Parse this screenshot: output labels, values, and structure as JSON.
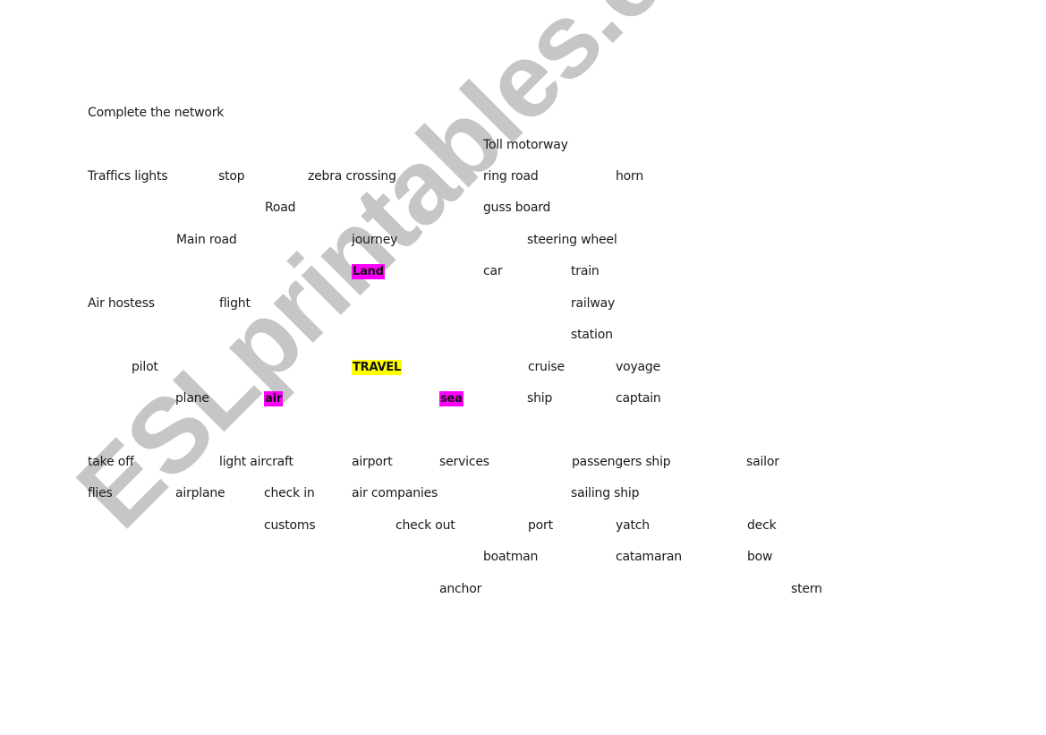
{
  "watermark": "ESLprintables.com",
  "instruction": "Complete the network",
  "highlight_colors": {
    "center": "#ffff00",
    "category": "#ff00ff"
  },
  "center": "TRAVEL",
  "categories": {
    "land": "Land",
    "air": "air",
    "sea": "sea"
  },
  "words": {
    "toll_motorway": "Toll motorway",
    "traffics_lights": "Traffics lights",
    "stop": "stop",
    "zebra_crossing": "zebra crossing",
    "ring_road": "ring road",
    "horn": "horn",
    "road": "Road",
    "guss_board": "guss board",
    "main_road": "Main road",
    "journey": "journey",
    "steering_wheel": "steering wheel",
    "car": "car",
    "train": "train",
    "air_hostess": "Air hostess",
    "flight": "flight",
    "railway": "railway",
    "station": "station",
    "pilot": "pilot",
    "cruise": "cruise",
    "voyage": "voyage",
    "plane": "plane",
    "ship": "ship",
    "captain": "captain",
    "take_off": "take off",
    "light_aircraft": "light aircraft",
    "airport": "airport",
    "services": "services",
    "passengers_ship": "passengers ship",
    "sailor": "sailor",
    "flies": "flies",
    "airplane": "airplane",
    "check_in": "check in",
    "air_companies": "air companies",
    "sailing_ship": "sailing ship",
    "customs": "customs",
    "check_out": "check out",
    "port": "port",
    "yatch": "yatch",
    "deck": "deck",
    "boatman": "boatman",
    "catamaran": "catamaran",
    "bow": "bow",
    "anchor": "anchor",
    "stern": "stern"
  }
}
